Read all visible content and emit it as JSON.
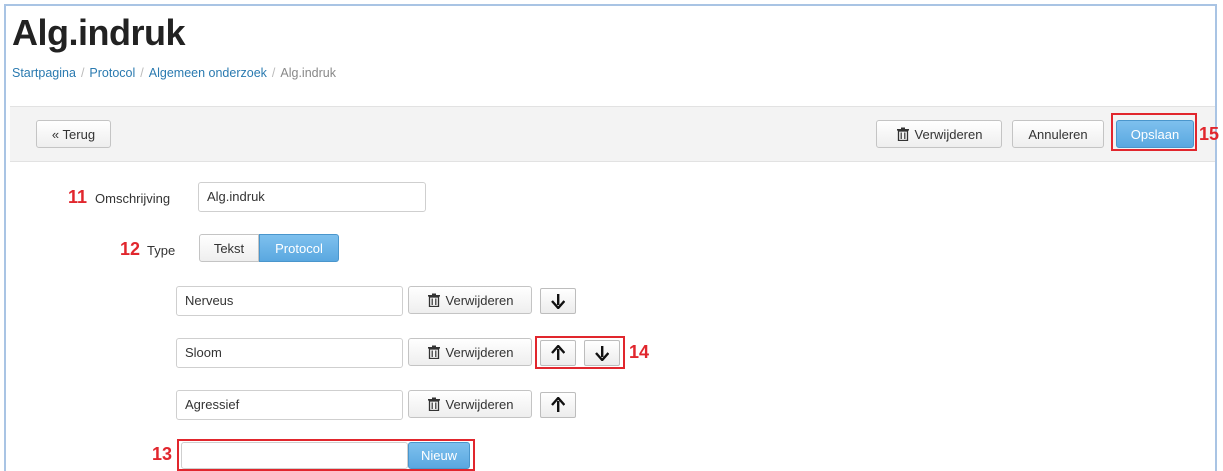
{
  "page": {
    "title": "Alg.indruk"
  },
  "breadcrumb": [
    {
      "label": "Startpagina"
    },
    {
      "label": "Protocol"
    },
    {
      "label": "Algemeen onderzoek"
    },
    {
      "label": "Alg.indruk"
    }
  ],
  "toolbar": {
    "back_label": "« Terug",
    "delete_label": "Verwijderen",
    "cancel_label": "Annuleren",
    "save_label": "Opslaan"
  },
  "form": {
    "description_label": "Omschrijving",
    "description_value": "Alg.indruk",
    "type_label": "Type",
    "type_options": [
      "Tekst",
      "Protocol"
    ],
    "type_selected": "Protocol",
    "items": [
      {
        "value": "Nerveus",
        "delete_label": "Verwijderen"
      },
      {
        "value": "Sloom",
        "delete_label": "Verwijderen"
      },
      {
        "value": "Agressief",
        "delete_label": "Verwijderen"
      }
    ],
    "new_item_value": "",
    "new_label": "Nieuw"
  },
  "annotations": {
    "n11": "11",
    "n12": "12",
    "n13": "13",
    "n14": "14",
    "n15": "15"
  },
  "colors": {
    "accent": "#5aa8e0",
    "annotation": "#e1262d",
    "link": "#2a7ab0"
  }
}
